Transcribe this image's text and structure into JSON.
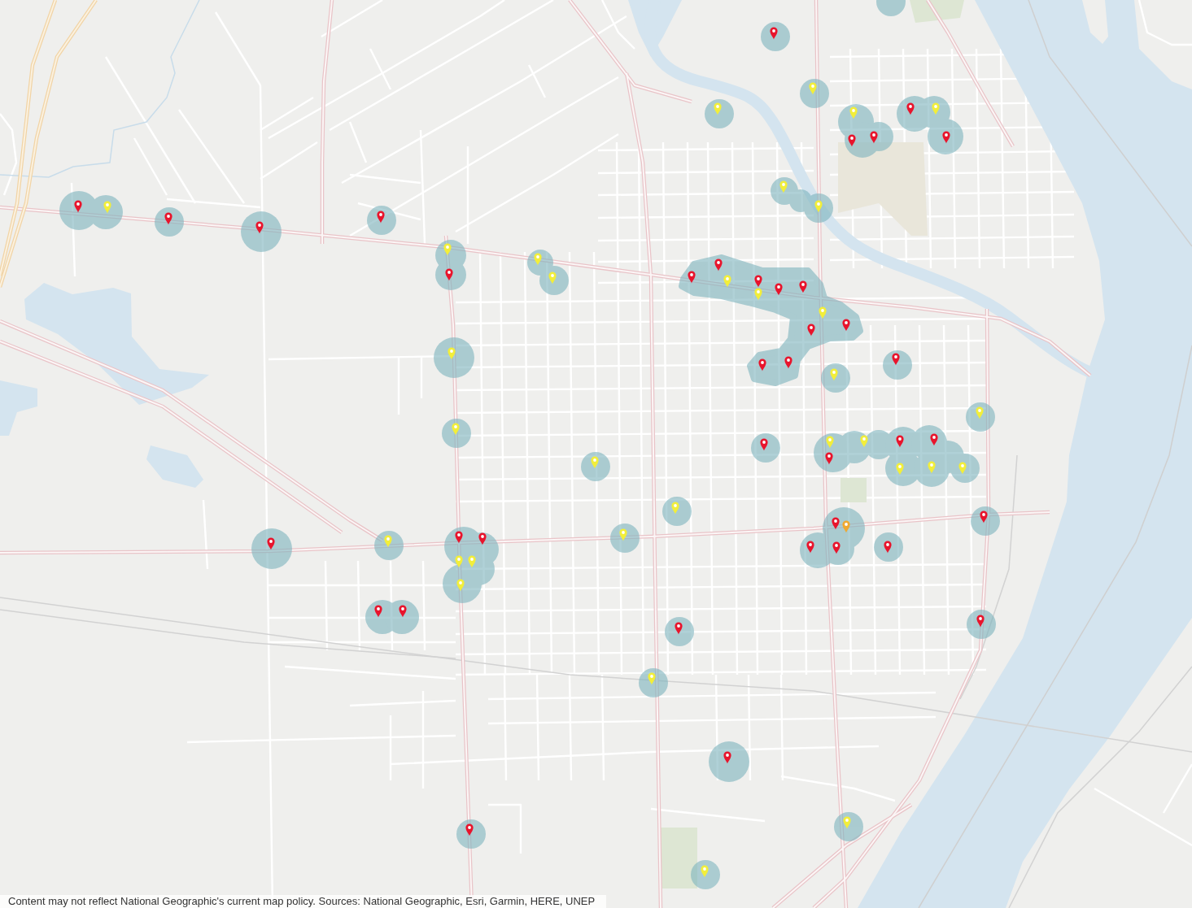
{
  "map": {
    "markers": [
      {
        "color": "#e8142c"
      },
      {
        "color": "#f2ee3a"
      },
      {
        "color": "#e8142c"
      },
      {
        "color": "#e8142c"
      },
      {
        "color": "#e8142c"
      },
      {
        "color": "#f2ee3a"
      },
      {
        "color": "#e8142c"
      },
      {
        "color": "#f2ee3a"
      },
      {
        "color": "#f2ee3a"
      },
      {
        "color": "#f2ee3a"
      },
      {
        "color": "#f2ee3a"
      },
      {
        "color": "#f2ee3a"
      },
      {
        "color": "#f2ee3a"
      },
      {
        "color": "#f2ee3a"
      },
      {
        "color": "#f2ee3a"
      },
      {
        "color": "#e8142c"
      },
      {
        "color": "#e8142c"
      },
      {
        "color": "#e8142c"
      },
      {
        "color": "#f2ee3a"
      },
      {
        "color": "#f2ee3a"
      },
      {
        "color": "#f2ee3a"
      },
      {
        "color": "#e8142c"
      },
      {
        "color": "#e8142c"
      },
      {
        "color": "#e8142c"
      },
      {
        "color": "#f2ee3a"
      },
      {
        "color": "#e8142c"
      },
      {
        "color": "#e8142c"
      },
      {
        "color": "#f2ee3a"
      },
      {
        "color": "#f2ee3a"
      },
      {
        "color": "#e8142c"
      },
      {
        "color": "#f2ee3a"
      },
      {
        "color": "#f2ee3a"
      },
      {
        "color": "#f2ee3a"
      },
      {
        "color": "#e8142c"
      },
      {
        "color": "#e8142c"
      },
      {
        "color": "#e8142c"
      },
      {
        "color": "#f2ee3a"
      },
      {
        "color": "#e8142c"
      },
      {
        "color": "#f2ee3a"
      },
      {
        "color": "#f2ee3a"
      },
      {
        "color": "#e8142c"
      },
      {
        "color": "#e8142c"
      },
      {
        "color": "#f2ee3a"
      },
      {
        "color": "#e8142c"
      },
      {
        "color": "#f2ee3a"
      },
      {
        "color": "#e8142c"
      },
      {
        "color": "#e8142c"
      },
      {
        "color": "#f2ee3a"
      },
      {
        "color": "#e8142c"
      },
      {
        "color": "#e8142c"
      },
      {
        "color": "#e8142c"
      },
      {
        "color": "#e8142c"
      },
      {
        "color": "#f2ee3a"
      },
      {
        "color": "#e8142c"
      },
      {
        "color": "#f2ee3a"
      },
      {
        "color": "#e8142c"
      },
      {
        "color": "#f2ee3a"
      },
      {
        "color": "#e8142c"
      },
      {
        "color": "#f2ee3a"
      },
      {
        "color": "#e8142c"
      },
      {
        "color": "#e8142c"
      },
      {
        "color": "#f2ee3a"
      },
      {
        "color": "#f2ee3a"
      },
      {
        "color": "#f2ee3a"
      },
      {
        "color": "#e8142c"
      },
      {
        "color": "#e8142c"
      },
      {
        "color": "#f0a830"
      },
      {
        "color": "#e8142c"
      },
      {
        "color": "#e8142c"
      },
      {
        "color": "#e8142c"
      },
      {
        "color": "#e8142c"
      }
    ]
  },
  "attribution": "Content may not reflect National Geographic's current map policy. Sources: National Geographic, Esri, Garmin, HERE, UNEP"
}
